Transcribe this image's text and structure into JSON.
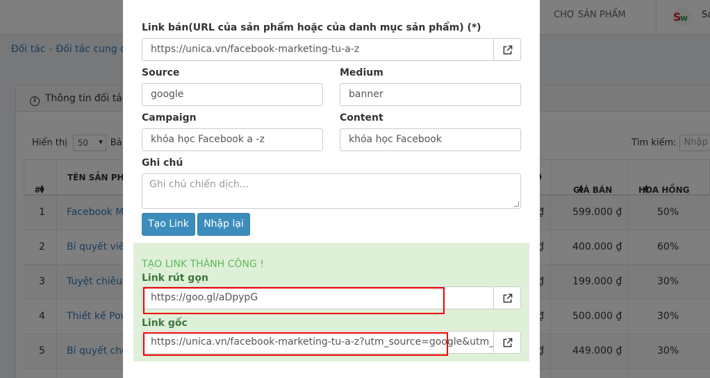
{
  "topbar": {
    "market_label": "CHỢ SẢN PHẨM",
    "user_initial": "Sa"
  },
  "breadcrumb": {
    "items": [
      "Đối tác",
      "Đối tác cung cấp"
    ]
  },
  "panel": {
    "title": "Thông tin đối tác"
  },
  "table_controls": {
    "show_label": "Hiển thị",
    "page_size": "50",
    "after_select": "Bả",
    "search_label": "Tìm kiếm:",
    "search_placeholder": "Nhập t"
  },
  "table": {
    "headers": [
      "#",
      "TÊN SẢN PHẨM",
      "GIÁ BÁN",
      "HOA HỒNG"
    ],
    "rows": [
      {
        "num": "1",
        "name": "Facebook Ma",
        "mark": "₫",
        "price": "599.000 ₫",
        "commission": "50%"
      },
      {
        "num": "2",
        "name": "Bí quyết viết",
        "mark": "₫",
        "price": "400.000 ₫",
        "commission": "60%"
      },
      {
        "num": "3",
        "name": "Tuyệt chiêu ",
        "mark": "₫",
        "price": "199.000 ₫",
        "commission": "30%"
      },
      {
        "num": "4",
        "name": "Thiết kế Pow",
        "mark": "₫",
        "price": "500.000 ₫",
        "commission": "30%"
      },
      {
        "num": "5",
        "name": "Bí quyết chố",
        "mark": "₫",
        "price": "449.000 ₫",
        "commission": "30%"
      }
    ]
  },
  "modal": {
    "url_label": "Link bán(URL của sản phẩm hoặc của danh mục sản phẩm) (*)",
    "url_value": "https://unica.vn/facebook-marketing-tu-a-z",
    "source_label": "Source",
    "source_value": "google",
    "medium_label": "Medium",
    "medium_value": "banner",
    "campaign_label": "Campaign",
    "campaign_value": "khóa học Facebook a -z",
    "content_label": "Content",
    "content_value": "khóa học Facebook",
    "note_label": "Ghi chú",
    "note_placeholder": "Ghi chú chiến dịch...",
    "create_button": "Tạo Link",
    "reset_button": "Nhập lại",
    "success_message": "TẠO LINK THÀNH CÔNG !",
    "short_link_label": "Link rút gọn",
    "short_link_value": "https://goo.gl/aDpypG",
    "original_link_label": "Link gốc",
    "original_link_value": "https://unica.vn/facebook-marketing-tu-a-z?utm_source=google&utm_medium=banner"
  },
  "colors": {
    "primary_button": "#3c8dbc",
    "success_bg": "#dff0d8",
    "success_text": "#5cb85c",
    "highlight_box": "#e00000",
    "link": "#337ab7"
  },
  "icons": [
    "external-link-icon",
    "info-icon",
    "sort-icon",
    "logo-icon"
  ]
}
